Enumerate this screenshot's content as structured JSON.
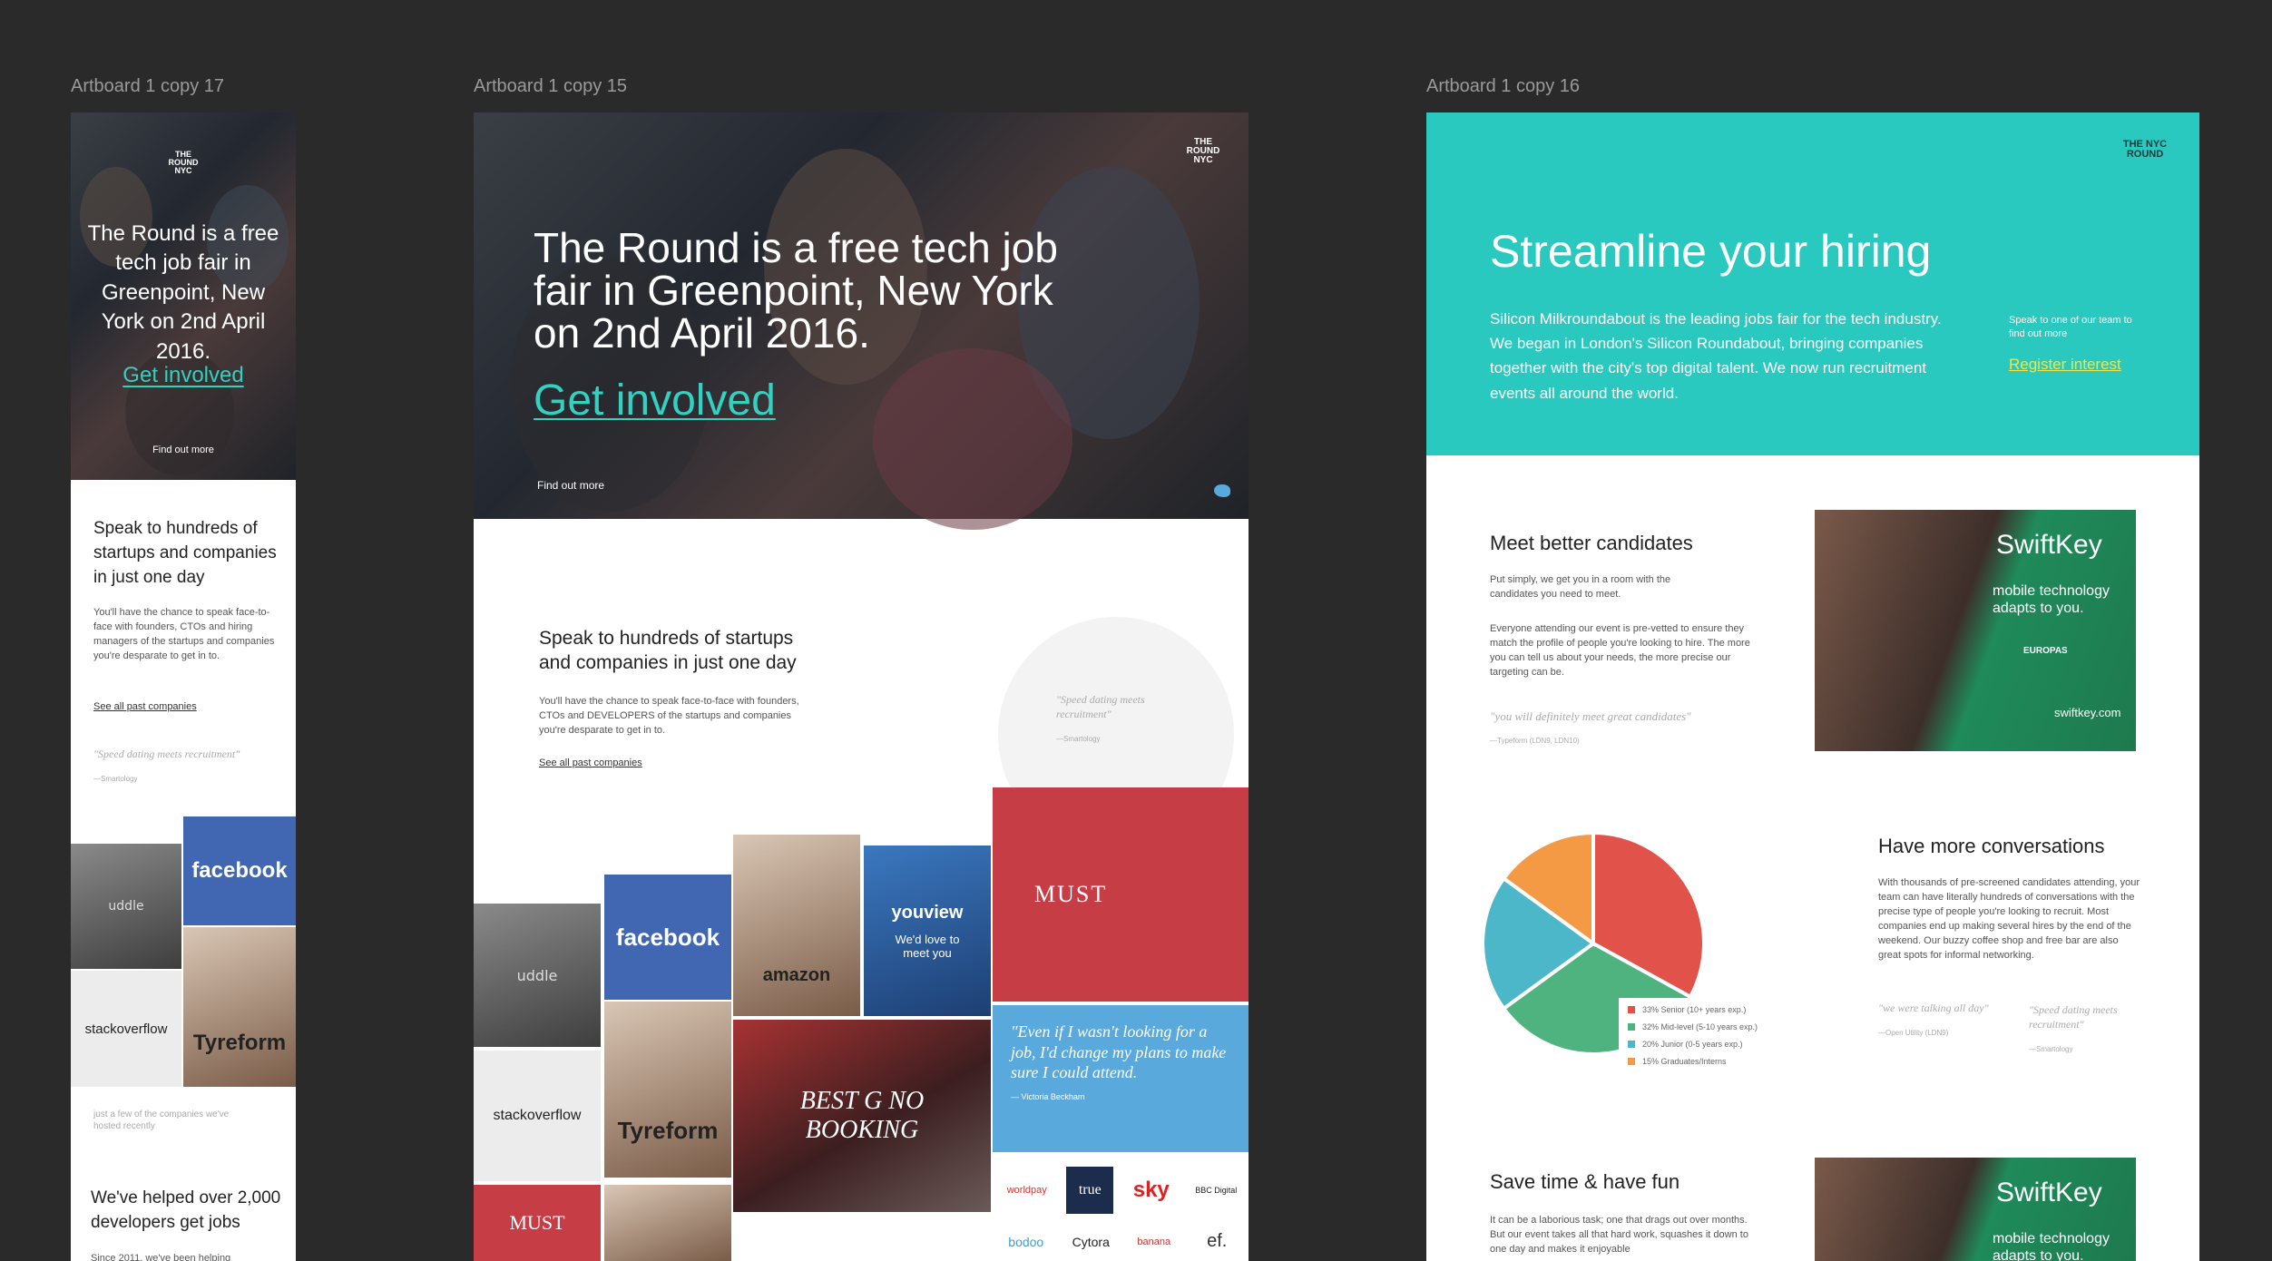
{
  "artboards": {
    "a17": {
      "label": "Artboard 1 copy 17"
    },
    "a15": {
      "label": "Artboard 1 copy 15"
    },
    "a16": {
      "label": "Artboard 1 copy 16"
    }
  },
  "logo": {
    "line1": "THE",
    "line2": "ROUND",
    "line3": "NYC"
  },
  "hero": {
    "title": "The Round is a free tech job fair in Greenpoint, New York on 2nd April 2016.",
    "cta": "Get involved",
    "find_out": "Find out more"
  },
  "speak": {
    "title": "Speak to hundreds of startups and companies in just one day",
    "body_mobile": "You'll have the chance to speak face-to-face with founders, CTOs and hiring managers of the startups and companies you're desparate to get in to.",
    "body_desktop": "You'll have the chance to speak face-to-face with founders, CTOs and DEVELOPERS of the startups and companies you're desparate to get in to.",
    "link": "See all past companies",
    "quote": "\"Speed dating meets recruitment\"",
    "quote_attr": "—Smartology"
  },
  "tiles": {
    "facebook": "facebook",
    "stackoverflow": "stackoverflow",
    "typeform": "Tyreform",
    "amazon": "amazon",
    "youview": "youview",
    "youview_sub": "We'd love to meet you",
    "must": "MUST",
    "best": "BEST G NO BOOKING"
  },
  "blue_quote": {
    "text": "\"Even if I wasn't looking for a job, I'd change my plans to make sure I could attend.",
    "attr": "— Victoria Beckham"
  },
  "brands": [
    "worldpay",
    "true",
    "sky",
    "BBC Digital",
    "bodoo",
    "Cytora",
    "banana",
    "ef."
  ],
  "mobile_extra": {
    "caption": "just a few of the companies we've hosted recently",
    "helped": "We've helped over 2,000 developers get jobs",
    "since": "Since 2011, we've been helping"
  },
  "hiring": {
    "title": "Streamline your hiring",
    "body": "Silicon Milkroundabout is the leading jobs fair for the tech industry. We began in London's Silicon Roundabout, bringing companies together with the city's top digital talent. We now run recruitment events all around the world.",
    "aside": "Speak to one of our team to find out more",
    "register": "Register interest"
  },
  "candidates": {
    "title": "Meet better candidates",
    "p1": "Put simply, we get you in a room with the candidates you need to meet.",
    "p2": "Everyone attending our event is pre-vetted to ensure they match the profile of people you're looking to hire. The more you can tell us about your needs, the more precise our targeting can be.",
    "quote": "\"you will definitely meet great candidates\"",
    "attr": "—Typeform (LDN9, LDN10)"
  },
  "swiftkey": {
    "brand": "SwiftKey",
    "tagline": "mobile technology adapts to you.",
    "award": "EUROPAS",
    "url": "swiftkey.com"
  },
  "conversations": {
    "title": "Have more conversations",
    "body": "With thousands of pre-screened candidates attending, your team can have literally hundreds of conversations with the precise type of people you're looking to recruit. Most companies end up making several hires by the end of the weekend. Our buzzy coffee shop and free bar are also great spots for informal networking.",
    "quote1": "\"we were talking all day\"",
    "attr1": "—Open Utility (LDN9)",
    "quote2": "\"Speed dating meets recruitment\"",
    "attr2": "—Smartology"
  },
  "chart_data": {
    "type": "pie",
    "categories": [
      "33% Senior (10+ years exp.)",
      "32% Mid-level (5-10 years exp.)",
      "20% Junior (0-5 years exp.)",
      "15% Graduates/Interns"
    ],
    "values": [
      33,
      32,
      20,
      15
    ],
    "colors": [
      "#e0524a",
      "#4fb380",
      "#4bb7c8",
      "#f49a44"
    ]
  },
  "fun": {
    "title": "Save time & have fun",
    "body": "It can be a laborious task; one that drags out over months. But our event takes all that hard work, squashes it down to one day and makes it enjoyable"
  },
  "colors": {
    "teal": "#2ac9c0",
    "link_teal": "#34d0c0",
    "yellow_link": "#f4e542",
    "facebook": "#4267b2"
  }
}
